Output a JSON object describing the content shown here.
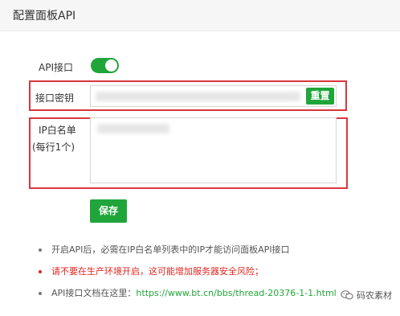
{
  "dialog": {
    "title": "配置面板API"
  },
  "form": {
    "api_label": "API接口",
    "api_enabled": true,
    "secret_label": "接口密钥",
    "secret_value": "",
    "reset_button": "重置",
    "ip_label_line1": "IP白名单",
    "ip_label_line2": "(每行1个)",
    "ip_whitelist_value": "",
    "save_button": "保存"
  },
  "notes": {
    "note1": "开启API后，必需在IP白名单列表中的IP才能访问面板API接口",
    "note2": "请不要在生产环境开启，这可能增加服务器安全风险；",
    "note3_prefix": "API接口文档在这里：",
    "note3_link": "https://www.bt.cn/bbs/thread-20376-1-1.html"
  },
  "watermark": {
    "text": "码农素材",
    "icon": "wechat-icon"
  },
  "colors": {
    "accent": "#20a53a",
    "highlight_border": "#d9363e",
    "warning_text": "#e0261f"
  }
}
